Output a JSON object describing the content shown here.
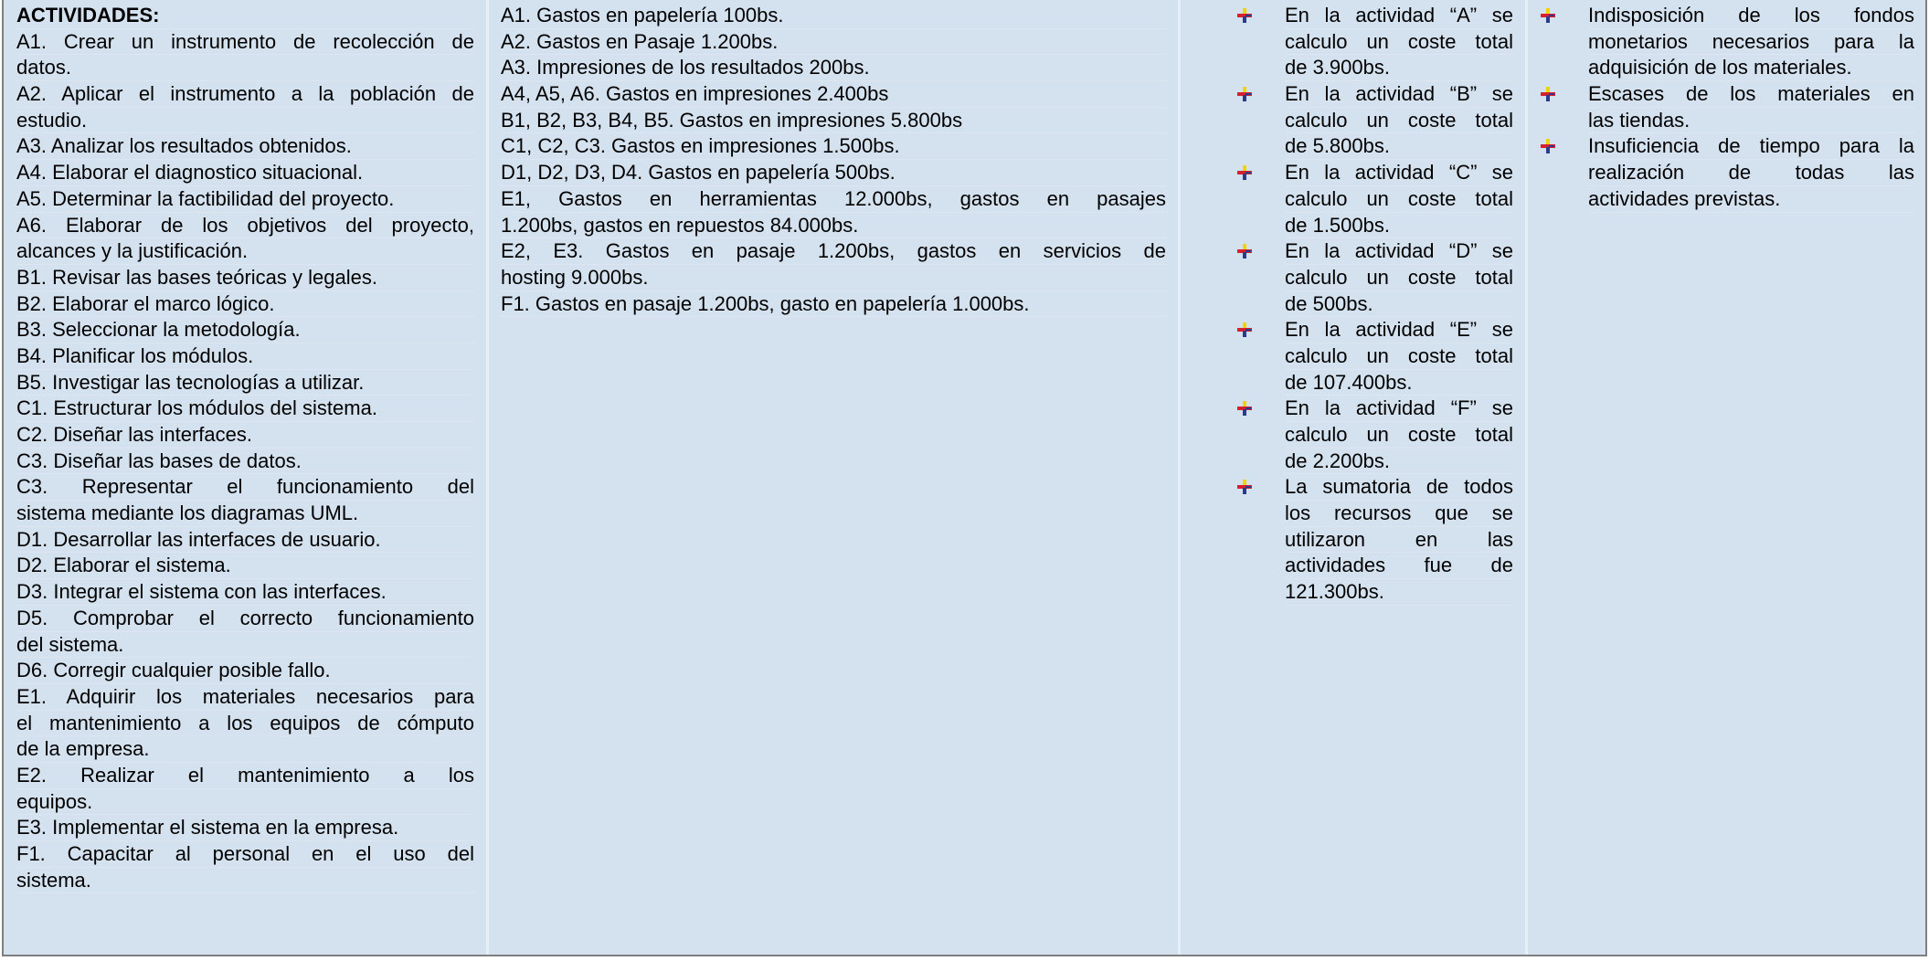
{
  "activities": {
    "lines": [
      {
        "text": "ACTIVIDADES:",
        "bold": true,
        "last": true
      },
      {
        "text": "A1. Crear un instrumento de recolección de",
        "last": false
      },
      {
        "text": "datos.",
        "last": true
      },
      {
        "text": "A2. Aplicar el instrumento a la población de",
        "last": false
      },
      {
        "text": "estudio.",
        "last": true
      },
      {
        "text": "A3. Analizar los resultados obtenidos.",
        "last": true
      },
      {
        "text": "A4. Elaborar el diagnostico situacional.",
        "last": true
      },
      {
        "text": "A5. Determinar la factibilidad del proyecto.",
        "last": true
      },
      {
        "text": "A6. Elaborar de los objetivos del proyecto,",
        "last": false
      },
      {
        "text": "alcances y la justificación.",
        "last": true
      },
      {
        "text": "B1. Revisar  las bases teóricas y legales.",
        "last": true
      },
      {
        "text": "B2. Elaborar el marco lógico.",
        "last": true
      },
      {
        "text": "B3. Seleccionar la metodología.",
        "last": true
      },
      {
        "text": "B4. Planificar los módulos.",
        "last": true
      },
      {
        "text": "B5. Investigar las tecnologías a utilizar.",
        "last": true
      },
      {
        "text": "C1. Estructurar los módulos del sistema.",
        "last": true
      },
      {
        "text": "C2. Diseñar las interfaces.",
        "last": true
      },
      {
        "text": "C3. Diseñar las bases de datos.",
        "last": true
      },
      {
        "text": "C3.  Representar  el  funcionamiento  del",
        "last": false
      },
      {
        "text": "sistema mediante los diagramas UML.",
        "last": true
      },
      {
        "text": "D1. Desarrollar las interfaces de usuario.",
        "last": true
      },
      {
        "text": "D2. Elaborar el sistema.",
        "last": true
      },
      {
        "text": "D3. Integrar el sistema con las interfaces.",
        "last": true
      },
      {
        "text": "D5.  Comprobar  el  correcto  funcionamiento",
        "last": false
      },
      {
        "text": "del sistema.",
        "last": true
      },
      {
        "text": "D6. Corregir cualquier posible fallo.",
        "last": true
      },
      {
        "text": "E1.  Adquirir  los  materiales  necesarios  para",
        "last": false
      },
      {
        "text": "el mantenimiento a los equipos de cómputo",
        "last": false
      },
      {
        "text": "de la empresa.",
        "last": true
      },
      {
        "text": "E2.   Realizar    el   mantenimiento   a   los",
        "last": false
      },
      {
        "text": "equipos.",
        "last": true
      },
      {
        "text": "E3. Implementar el sistema en la empresa.",
        "last": true
      },
      {
        "text": "F1.  Capacitar  al  personal  en  el  uso  del",
        "last": false
      },
      {
        "text": "sistema.",
        "last": true
      }
    ]
  },
  "costs": {
    "lines": [
      {
        "text": "A1. Gastos en papelería 100bs.",
        "last": true
      },
      {
        "text": "A2. Gastos en Pasaje 1.200bs.",
        "last": true
      },
      {
        "text": "A3. Impresiones de los resultados 200bs.",
        "last": true
      },
      {
        "text": "A4, A5, A6. Gastos en impresiones 2.400bs",
        "last": true
      },
      {
        "text": "B1, B2, B3, B4, B5. Gastos en impresiones 5.800bs",
        "last": true
      },
      {
        "text": "C1, C2, C3. Gastos en impresiones 1.500bs.",
        "last": true
      },
      {
        "text": "D1, D2, D3, D4. Gastos en papelería 500bs.",
        "last": true
      },
      {
        "text": "E1,  Gastos  en  herramientas  12.000bs,  gastos  en  pasajes",
        "last": false
      },
      {
        "text": "1.200bs, gastos en repuestos 84.000bs.",
        "last": true
      },
      {
        "text": "E2,  E3.  Gastos  en  pasaje  1.200bs,  gastos  en  servicios  de",
        "last": false
      },
      {
        "text": "hosting 9.000bs.",
        "last": true
      },
      {
        "text": "F1. Gastos en pasaje 1.200bs, gasto en papelería 1.000bs.",
        "last": true
      }
    ]
  },
  "totals": {
    "items": [
      {
        "lines": [
          "En la actividad “A” se",
          "calculo un coste total",
          "de 3.900bs."
        ]
      },
      {
        "lines": [
          "En la actividad “B” se",
          "calculo un coste total",
          "de 5.800bs."
        ]
      },
      {
        "lines": [
          "En la actividad “C” se",
          "calculo un coste total",
          "de 1.500bs."
        ]
      },
      {
        "lines": [
          "En la actividad “D” se",
          "calculo un coste total",
          "de 500bs."
        ]
      },
      {
        "lines": [
          "En la actividad “E” se",
          "calculo un coste total",
          "de 107.400bs."
        ]
      },
      {
        "lines": [
          "En la actividad “F” se",
          "calculo un coste total",
          "de 2.200bs."
        ]
      },
      {
        "lines": [
          "La sumatoria de todos",
          "los recursos que se",
          "utilizaron      en      las",
          "actividades     fue     de",
          "121.300bs."
        ]
      }
    ]
  },
  "risks": {
    "items": [
      {
        "lines": [
          "Indisposición  de  los  fondos",
          "monetarios necesarios para la",
          "adquisición de los materiales."
        ]
      },
      {
        "lines": [
          "Escases  de  los  materiales  en",
          "las tiendas."
        ]
      },
      {
        "lines": [
          "Insuficiencia de tiempo para la",
          "realización      de      todas      las",
          "actividades previstas."
        ]
      }
    ]
  },
  "colors": {
    "cell_background": "#d4e1ee",
    "bullet_red": "#d7202e",
    "bullet_yellow": "#f2d200",
    "bullet_blue": "#2a3b8f"
  }
}
